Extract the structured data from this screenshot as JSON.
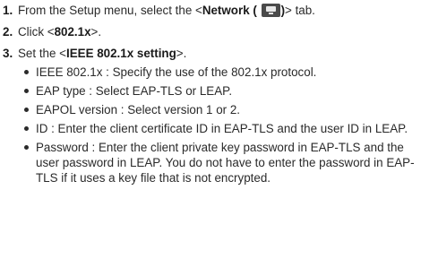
{
  "steps": [
    {
      "number": "1.",
      "text_before": "From the Setup menu, select the <",
      "bold": "Network (",
      "icon": "monitor-icon",
      "bold_after": ")",
      "text_after": "> tab."
    },
    {
      "number": "2.",
      "text_before": "Click <",
      "bold": "802.1x",
      "text_after": ">."
    },
    {
      "number": "3.",
      "text_before": "Set the <",
      "bold": "IEEE 802.1x setting",
      "text_after": ">."
    }
  ],
  "bullets": [
    "IEEE 802.1x : Specify the use of the 802.1x protocol.",
    "EAP type : Select EAP-TLS or LEAP.",
    "EAPOL version : Select version 1 or 2.",
    "ID : Enter the client certificate ID in EAP-TLS and the user ID in LEAP.",
    "Password : Enter the client private key password in EAP-TLS and the user password in LEAP. You do not have to enter the password in EAP-TLS if it uses a key file that is not encrypted."
  ]
}
